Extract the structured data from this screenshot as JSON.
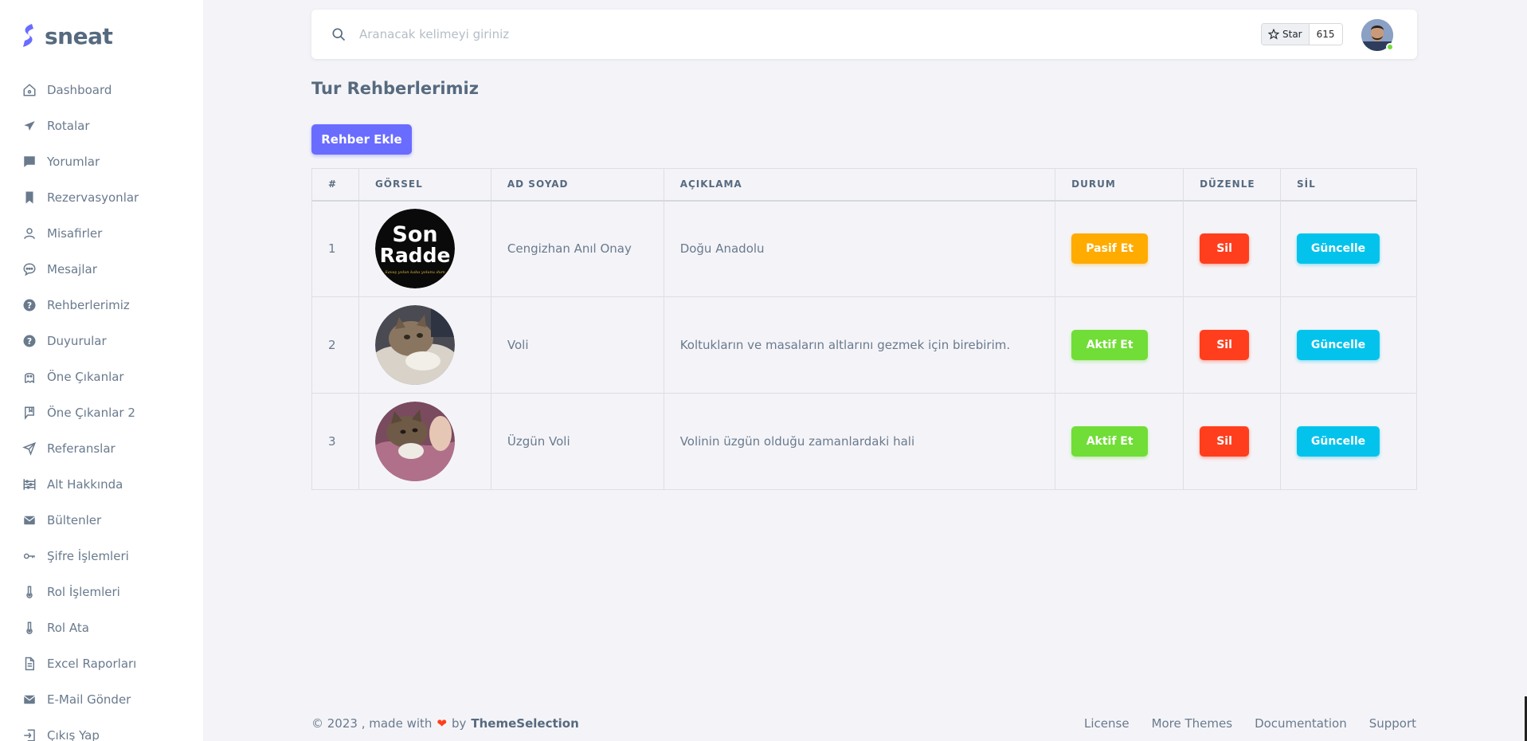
{
  "brand": {
    "name": "sneat",
    "color": "#696cff"
  },
  "sidebar": {
    "items": [
      {
        "label": "Dashboard",
        "icon": "home-icon"
      },
      {
        "label": "Rotalar",
        "icon": "plane-icon"
      },
      {
        "label": "Yorumlar",
        "icon": "comment-icon"
      },
      {
        "label": "Rezervasyonlar",
        "icon": "bookmark-icon"
      },
      {
        "label": "Misafirler",
        "icon": "user-icon"
      },
      {
        "label": "Mesajlar",
        "icon": "chat-bubble-icon"
      },
      {
        "label": "Rehberlerimiz",
        "icon": "help-circle-icon"
      },
      {
        "label": "Duyurular",
        "icon": "help-circle-icon"
      },
      {
        "label": "Öne Çıkanlar",
        "icon": "ghost-icon"
      },
      {
        "label": "Öne Çıkanlar 2",
        "icon": "book-bookmark-icon"
      },
      {
        "label": "Referanslar",
        "icon": "send-icon"
      },
      {
        "label": "Alt Hakkında",
        "icon": "abacus-icon"
      },
      {
        "label": "Bültenler",
        "icon": "envelope-icon"
      },
      {
        "label": "Şifre İşlemleri",
        "icon": "key-icon"
      },
      {
        "label": "Rol İşlemleri",
        "icon": "thermometer-icon"
      },
      {
        "label": "Rol Ata",
        "icon": "thermometer-icon"
      },
      {
        "label": "Excel Raporları",
        "icon": "file-icon"
      },
      {
        "label": "E-Mail Gönder",
        "icon": "envelope-icon"
      },
      {
        "label": "Çıkış Yap",
        "icon": "log-out-icon"
      }
    ]
  },
  "navbar": {
    "search_placeholder": "Aranacak kelimeyi giriniz",
    "github": {
      "star_label": "Star",
      "count": "615"
    }
  },
  "page": {
    "title": "Tur Rehberlerimiz",
    "add_button": "Rehber Ekle"
  },
  "table": {
    "headers": [
      "#",
      "GÖRSEL",
      "AD SOYAD",
      "AÇIKLAMA",
      "DURUM",
      "DÜZENLE",
      "SİL"
    ],
    "rows": [
      {
        "num": "1",
        "image": "son-radde-logo",
        "name": "Cengizhan Anıl Onay",
        "description": "Doğu Anadolu",
        "status_label": "Pasif Et",
        "status_type": "warning",
        "delete_label": "Sil",
        "update_label": "Güncelle"
      },
      {
        "num": "2",
        "image": "cat-photo",
        "name": "Voli",
        "description": "Koltukların ve masaların altlarını gezmek için birebirim.",
        "status_label": "Aktif Et",
        "status_type": "success",
        "delete_label": "Sil",
        "update_label": "Güncelle"
      },
      {
        "num": "3",
        "image": "cat-photo-sad",
        "name": "Üzgün Voli",
        "description": "Volinin üzgün olduğu zamanlardaki hali",
        "status_label": "Aktif Et",
        "status_type": "success",
        "delete_label": "Sil",
        "update_label": "Güncelle"
      }
    ],
    "logo_text": {
      "line1": "Son",
      "line2": "Radde",
      "tagline": "Savaş yolun kaba yolunu dum"
    }
  },
  "footer": {
    "copyright": "© 2023 , made with",
    "by": "by",
    "brand": "ThemeSelection",
    "links": [
      "License",
      "More Themes",
      "Documentation",
      "Support"
    ]
  },
  "colors": {
    "primary": "#696cff",
    "warning": "#ffab00",
    "success": "#71dd37",
    "danger": "#ff3e1d",
    "info": "#03c3ec"
  }
}
